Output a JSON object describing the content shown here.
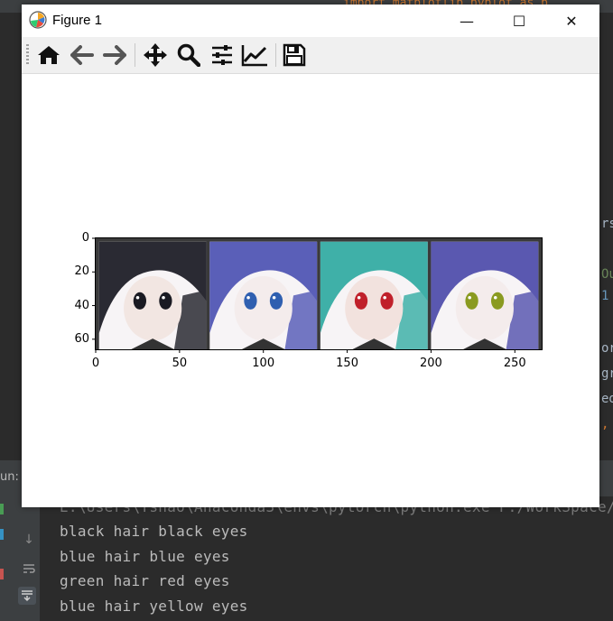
{
  "window": {
    "title": "Figure 1",
    "minimize_glyph": "—",
    "maximize_glyph": "☐",
    "close_glyph": "✕"
  },
  "toolbar": {
    "buttons": [
      {
        "name": "home-icon"
      },
      {
        "name": "back-icon"
      },
      {
        "name": "forward-icon"
      },
      {
        "name": "pan-icon"
      },
      {
        "name": "zoom-icon"
      },
      {
        "name": "subplots-config-icon"
      },
      {
        "name": "edit-axis-icon"
      },
      {
        "name": "save-icon"
      }
    ]
  },
  "chart_data": {
    "type": "image",
    "panels": [
      {
        "caption": "black hair black eyes",
        "hair_color": "#2a2a33",
        "eye_color": "#1a1a22",
        "skin": "#f2e6e2"
      },
      {
        "caption": "blue hair blue eyes",
        "hair_color": "#5a5fb8",
        "eye_color": "#2f5fb0",
        "skin": "#f4ecec"
      },
      {
        "caption": "green hair red eyes",
        "hair_color": "#3fb0a8",
        "eye_color": "#c0202a",
        "skin": "#f2e2de"
      },
      {
        "caption": "blue hair yellow eyes",
        "hair_color": "#5a58b0",
        "eye_color": "#8a9a20",
        "skin": "#f4ecec"
      }
    ],
    "xticks": [
      "0",
      "50",
      "100",
      "150",
      "200",
      "250"
    ],
    "yticks": [
      "0",
      "20",
      "40",
      "60"
    ],
    "xlim": [
      0,
      266
    ],
    "ylim": [
      66,
      0
    ]
  },
  "ide": {
    "top_fragment": "import matplotlib.pyplot as p",
    "right_fragments": [
      "rs",
      "Ou",
      "1",
      "or",
      "gr",
      "ed",
      ","
    ],
    "run_label": "un:",
    "console_lines": [
      "E:\\Users\\Yshao\\Anaconda3\\envs\\pytorch\\python.exe F:/WorkSpace/",
      "black hair black eyes",
      "blue hair blue eyes",
      "green hair red eyes",
      "blue hair yellow eyes"
    ]
  }
}
